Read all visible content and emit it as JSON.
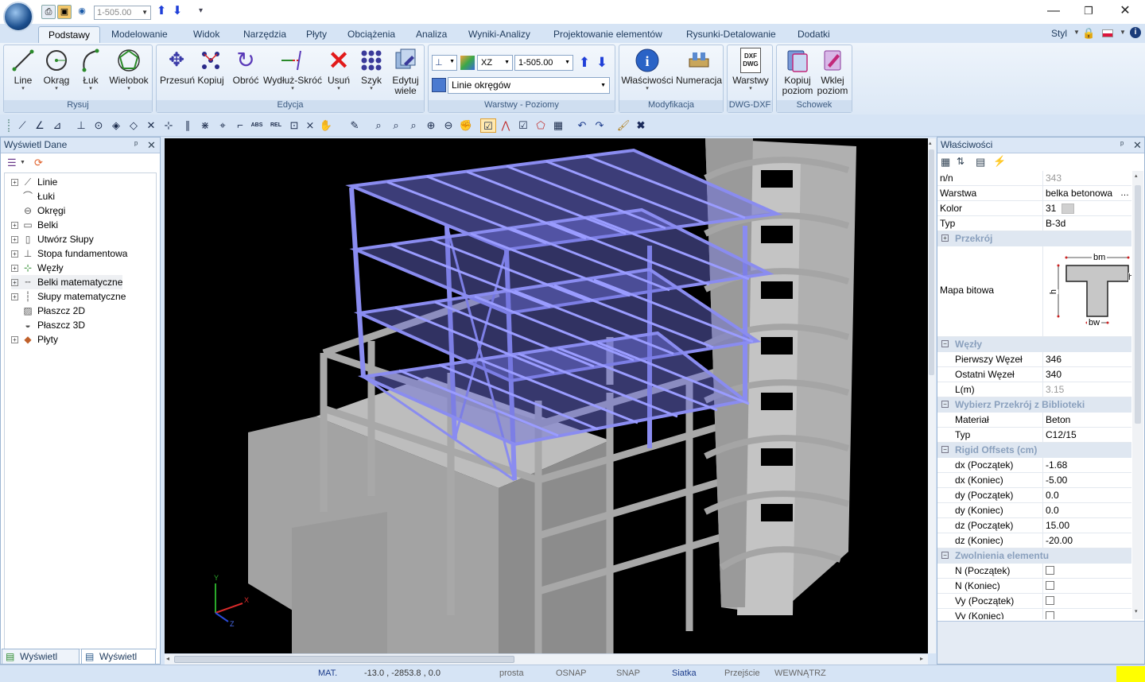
{
  "quick_access": {
    "level_value": "1-505.00"
  },
  "tabs": [
    "Podstawy",
    "Modelowanie",
    "Widok",
    "Narzędzia",
    "Płyty",
    "Obciążenia",
    "Analiza",
    "Wyniki-Analizy",
    "Projektowanie elementów",
    "Rysunki-Detalowanie",
    "Dodatki"
  ],
  "style_label": "Styl",
  "ribbon": {
    "rysuj": {
      "label": "Rysuj",
      "buttons": [
        "Line",
        "Okrąg",
        "Łuk",
        "Wielobok"
      ]
    },
    "edycja": {
      "label": "Edycja",
      "buttons": [
        "Przesuń",
        "Kopiuj",
        "Obróć",
        "Wydłuż-Skróć",
        "Usuń",
        "Szyk"
      ],
      "edit_many_line1": "Edytuj",
      "edit_many_line2": "wiele"
    },
    "warstwy_poziomy": {
      "label": "Warstwy - Poziomy",
      "plane": "XZ",
      "level": "1-505.00",
      "layer": "Linie okręgów"
    },
    "modyfikacja": {
      "label": "Modyfikacja",
      "buttons": [
        "Właściwości",
        "Numeracja"
      ]
    },
    "dwg": {
      "label": "DWG-DXF",
      "button": "Warstwy",
      "icon_text1": "DXF",
      "icon_text2": "DWG"
    },
    "schowek": {
      "label": "Schowek",
      "copy_line1": "Kopiuj",
      "copy_line2": "poziom",
      "paste_line1": "Wklej",
      "paste_line2": "poziom"
    }
  },
  "toolbar2": {
    "abs": "ABS",
    "rel": "REL"
  },
  "left_panel": {
    "title": "Wyświetl Dane",
    "items": [
      "Linie",
      "Łuki",
      "Okręgi",
      "Belki",
      "Utwórz Słupy",
      "Stopa fundamentowa",
      "Węzły",
      "Belki matematyczne",
      "Słupy matematyczne",
      "Płaszcz 2D",
      "Płaszcz 3D",
      "Płyty"
    ],
    "bottom_tabs": [
      "Wyświetl Par...",
      "Wyświetl Da..."
    ]
  },
  "axes": {
    "x": "X",
    "y": "Y",
    "z": "Z"
  },
  "properties": {
    "title": "Właściwości",
    "rows": [
      {
        "label": "n/n",
        "value": "343"
      },
      {
        "label": "Warstwa",
        "value": "belka betonowa"
      },
      {
        "label": "Kolor",
        "value": "31"
      },
      {
        "label": "Typ",
        "value": "B-3d"
      }
    ],
    "section_przekroj": "Przekrój",
    "bitmap_label": "Mapa bitowa",
    "section_bm": "bm",
    "section_bw": "bw",
    "section_h": "h",
    "cat_wezly": "Węzły",
    "wezly": [
      {
        "label": "Pierwszy Węzeł",
        "value": "346"
      },
      {
        "label": "Ostatni Węzeł",
        "value": "340"
      },
      {
        "label": "L(m)",
        "value": "3.15"
      }
    ],
    "cat_biblioteka": "Wybierz Przekrój z Biblioteki",
    "biblioteka": [
      {
        "label": "Materiał",
        "value": "Beton"
      },
      {
        "label": "Typ",
        "value": "C12/15"
      }
    ],
    "cat_rigid": "Rigid Offsets (cm)",
    "rigid": [
      {
        "label": "dx (Początek)",
        "value": "-1.68"
      },
      {
        "label": "dx (Koniec)",
        "value": "-5.00"
      },
      {
        "label": "dy (Początek)",
        "value": "0.0"
      },
      {
        "label": "dy (Koniec)",
        "value": "0.0"
      },
      {
        "label": "dz (Początek)",
        "value": "15.00"
      },
      {
        "label": "dz (Koniec)",
        "value": "-20.00"
      }
    ],
    "cat_zwolnienia": "Zwolnienia elementu",
    "zwolnienia": [
      "N (Początek)",
      "N (Koniec)",
      "Vy (Początek)",
      "Vy (Koniec)"
    ]
  },
  "status": {
    "mat": "MAT.",
    "coords": "-13.0 , -2853.8 , 0.0",
    "prosta": "prosta",
    "osnap": "OSNAP",
    "snap": "SNAP",
    "siatka": "Siatka",
    "przejscie": "Przejście",
    "wewnatrz": "WEWNĄTRZ"
  },
  "colors": {
    "steel": "#8888ee",
    "concrete": "#a9a9a9",
    "status_indicator": "#ffff00"
  }
}
